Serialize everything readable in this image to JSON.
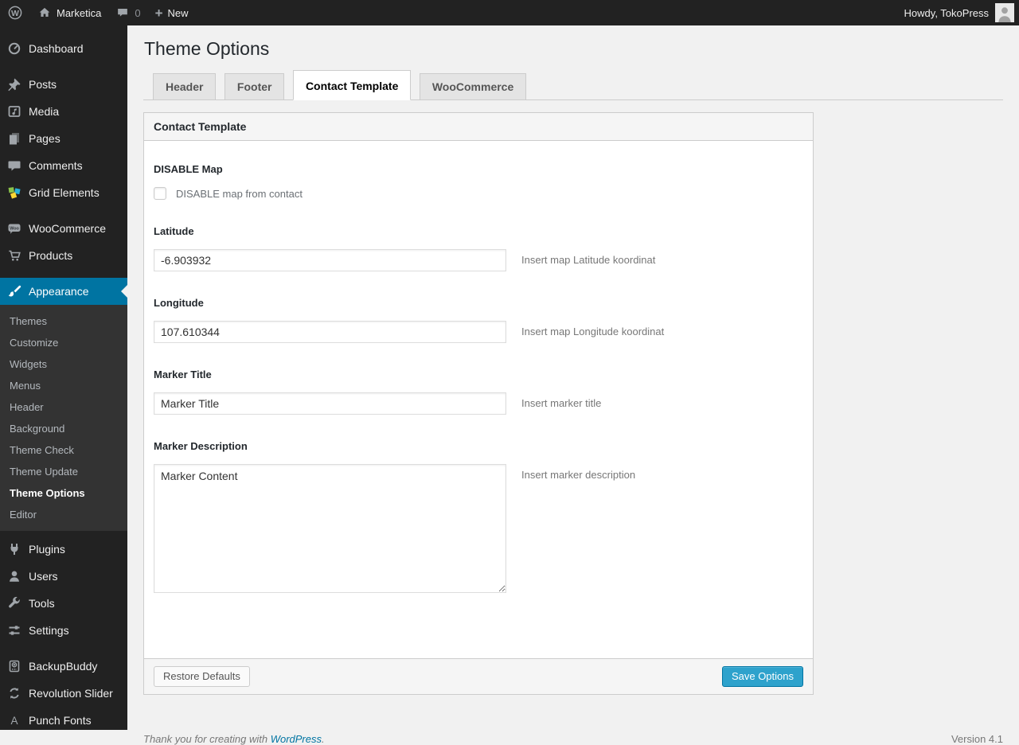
{
  "admin_bar": {
    "site_name": "Marketica",
    "comment_count": "0",
    "new_label": "New",
    "howdy_text": "Howdy, TokoPress"
  },
  "sidebar": {
    "items": [
      {
        "label": "Dashboard",
        "icon": "dashboard-icon"
      },
      {
        "label": "Posts",
        "icon": "pushpin-icon"
      },
      {
        "label": "Media",
        "icon": "media-icon"
      },
      {
        "label": "Pages",
        "icon": "pages-icon"
      },
      {
        "label": "Comments",
        "icon": "comments-icon"
      },
      {
        "label": "Grid Elements",
        "icon": "grid-elements-icon"
      },
      {
        "label": "WooCommerce",
        "icon": "woocommerce-icon"
      },
      {
        "label": "Products",
        "icon": "cart-icon"
      },
      {
        "label": "Appearance",
        "icon": "paintbrush-icon",
        "active": true
      },
      {
        "label": "Plugins",
        "icon": "plugin-icon"
      },
      {
        "label": "Users",
        "icon": "user-icon"
      },
      {
        "label": "Tools",
        "icon": "wrench-icon"
      },
      {
        "label": "Settings",
        "icon": "settings-icon"
      },
      {
        "label": "BackupBuddy",
        "icon": "backup-icon"
      },
      {
        "label": "Revolution Slider",
        "icon": "refresh-icon"
      },
      {
        "label": "Punch Fonts",
        "icon": "letter-a-icon"
      }
    ],
    "appearance_submenu": [
      {
        "label": "Themes"
      },
      {
        "label": "Customize"
      },
      {
        "label": "Widgets"
      },
      {
        "label": "Menus"
      },
      {
        "label": "Header"
      },
      {
        "label": "Background"
      },
      {
        "label": "Theme Check"
      },
      {
        "label": "Theme Update"
      },
      {
        "label": "Theme Options",
        "current": true
      },
      {
        "label": "Editor"
      }
    ]
  },
  "page": {
    "title": "Theme Options",
    "tabs": [
      {
        "label": "Header",
        "active": false
      },
      {
        "label": "Footer",
        "active": false
      },
      {
        "label": "Contact Template",
        "active": true
      },
      {
        "label": "WooCommerce",
        "active": false
      }
    ],
    "panel": {
      "header": "Contact Template",
      "fields": [
        {
          "label": "DISABLE Map",
          "type": "checkbox",
          "checkbox_label": "DISABLE map from contact",
          "checked": false
        },
        {
          "label": "Latitude",
          "type": "text",
          "value": "-6.903932",
          "hint": "Insert map Latitude koordinat"
        },
        {
          "label": "Longitude",
          "type": "text",
          "value": "107.610344",
          "hint": "Insert map Longitude koordinat"
        },
        {
          "label": "Marker Title",
          "type": "text",
          "value": "Marker Title",
          "hint": "Insert marker title"
        },
        {
          "label": "Marker Description",
          "type": "textarea",
          "value": "Marker Content",
          "hint": "Insert marker description"
        }
      ],
      "restore_button": "Restore Defaults",
      "save_button": "Save Options"
    }
  },
  "footer": {
    "thanks_prefix": "Thank you for creating with ",
    "wordpress_link": "WordPress",
    "thanks_suffix": ".",
    "version": "Version 4.1"
  },
  "colors": {
    "accent_blue": "#0074a2",
    "primary_button": "#2ea2cc",
    "admin_bar_bg": "#222222",
    "submenu_bg": "#333333",
    "page_bg": "#f1f1f1"
  }
}
